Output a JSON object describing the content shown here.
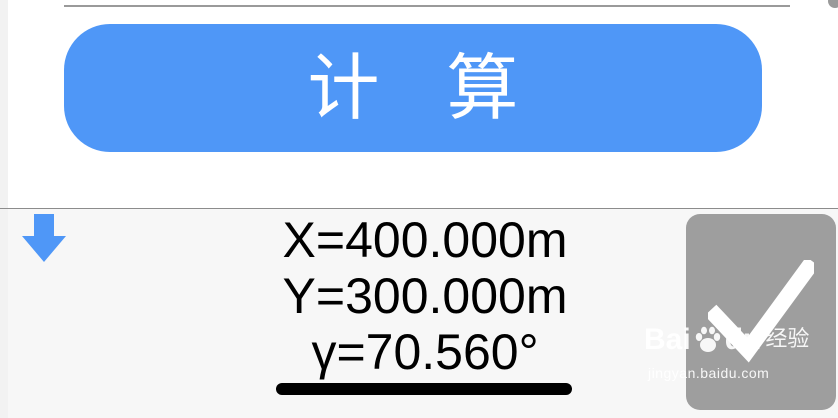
{
  "calculate_button": {
    "label": "计 算"
  },
  "results": {
    "x_line": "X=400.000m",
    "y_line": "Y=300.000m",
    "angle_line": "γ=70.560°"
  },
  "icons": {
    "down_arrow": "arrow-down-icon",
    "confirm": "checkmark-icon",
    "watermark_logo": "baidu-paw-icon"
  },
  "watermark": {
    "bai": "Bai",
    "du": "du",
    "exp": "经验",
    "url": "jingyan.baidu.com"
  },
  "colors": {
    "accent_blue": "#4f97f7",
    "confirm_gray": "#9e9e9e",
    "panel_bg": "#f7f7f7",
    "text": "#000000"
  }
}
